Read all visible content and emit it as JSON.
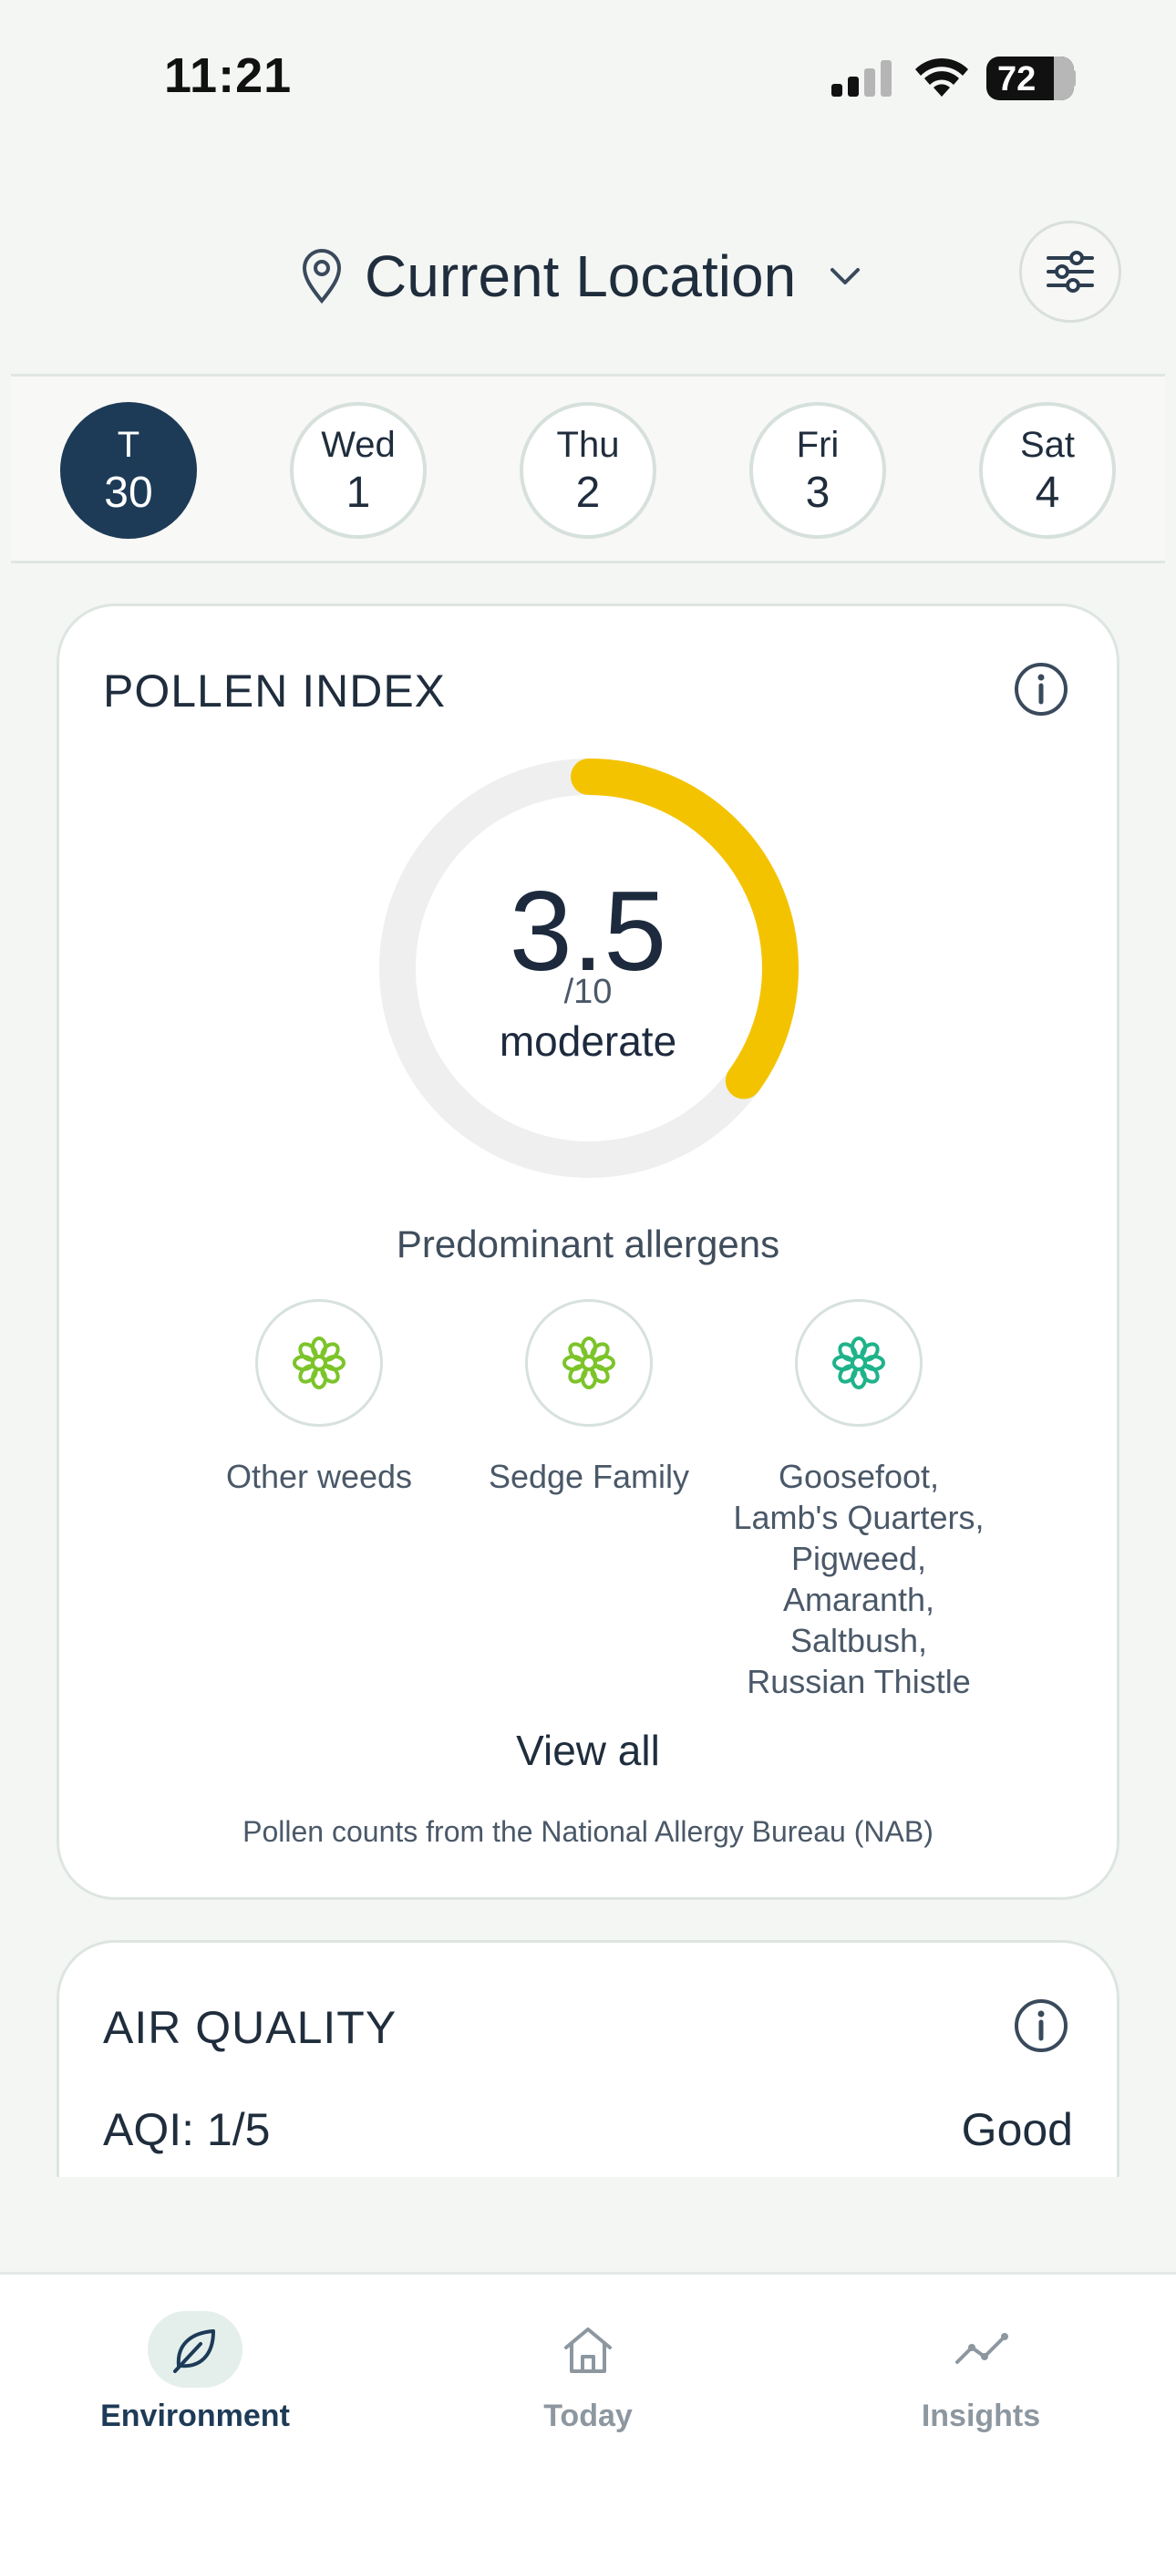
{
  "status_bar": {
    "time": "11:21",
    "battery": "72"
  },
  "header": {
    "location": "Current Location",
    "icons": [
      "location-pin-icon",
      "chevron-down-icon",
      "filter-sliders-icon"
    ]
  },
  "days": [
    {
      "name": "T",
      "num": "30",
      "selected": true
    },
    {
      "name": "Wed",
      "num": "1",
      "selected": false
    },
    {
      "name": "Thu",
      "num": "2",
      "selected": false
    },
    {
      "name": "Fri",
      "num": "3",
      "selected": false
    },
    {
      "name": "Sat",
      "num": "4",
      "selected": false
    }
  ],
  "pollen": {
    "title": "POLLEN INDEX",
    "value": "3.5",
    "scale": "/10",
    "level": "moderate",
    "gauge_fraction": 0.35,
    "gauge_color": "#f4c300",
    "track_color": "#eeefee",
    "allergens_heading": "Predominant allergens",
    "allergens": [
      {
        "name": "Other weeds",
        "color": "#7cc42a"
      },
      {
        "name": "Sedge Family",
        "color": "#7cc42a"
      },
      {
        "name": "Goosefoot, Lamb's Quarters, Pigweed, Amaranth, Saltbush, Russian Thistle",
        "color": "#1fb38a"
      }
    ],
    "view_all": "View all",
    "source": "Pollen counts from the National Allergy Bureau (NAB)"
  },
  "air_quality": {
    "title": "AIR QUALITY",
    "aqi": "AQI: 1/5",
    "status": "Good"
  },
  "nav": {
    "items": [
      {
        "label": "Environment",
        "icon": "leaf-icon",
        "active": true
      },
      {
        "label": "Today",
        "icon": "home-icon",
        "active": false
      },
      {
        "label": "Insights",
        "icon": "trend-line-icon",
        "active": false
      }
    ]
  }
}
